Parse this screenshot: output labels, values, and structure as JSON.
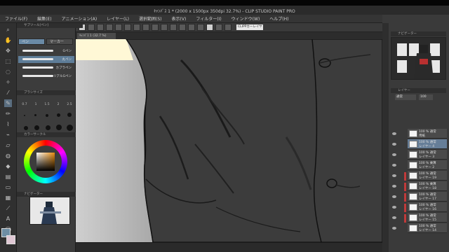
{
  "window": {
    "title": "ｷｬﾝﾊﾞｽ 1 * (2000 x 1500px 350dpi 32.7%) - CLIP STUDIO PAINT PRO"
  },
  "menu": [
    "ファイル(F)",
    "編集(E)",
    "アニメーション(A)",
    "レイヤー(L)",
    "選択範囲(S)",
    "表示(V)",
    "フィルター(I)",
    "ウィンドウ(W)",
    "ヘルプ(H)"
  ],
  "commandbar": {
    "field_text": "CLIPPカーレイヤー"
  },
  "tab": {
    "label": "ｷｬﾝﾊﾞｽ 1 (32.7 %)"
  },
  "subtool": {
    "header": "サブツール[ペン]",
    "tabs": [
      "ペン",
      "マーカー"
    ],
    "brushes": [
      {
        "label": "Gペン"
      },
      {
        "label": "丸ペン"
      },
      {
        "label": "カブラペン"
      },
      {
        "label": "リアルGペン"
      }
    ]
  },
  "size": {
    "header": "ブラシサイズ",
    "values": [
      "0.7",
      "1",
      "1.5",
      "2",
      "2.5"
    ]
  },
  "color": {
    "header": "カラーサークル"
  },
  "navigator": {
    "header": "ナビゲーター"
  },
  "right": {
    "navigator_header": "ナビゲーター",
    "layer_header": "レイヤー",
    "blend": "通常",
    "opacity": "100",
    "layers": [
      {
        "name1": "100 % 通常",
        "name2": "用紙"
      },
      {
        "name1": "100 % 通常",
        "name2": "レイヤー 4"
      },
      {
        "name1": "100 % 通常",
        "name2": "レイヤー 3"
      },
      {
        "name1": "100 % 乗算",
        "name2": "レイヤー 2"
      },
      {
        "name1": "100 % 通常",
        "name2": "レイヤー 19"
      },
      {
        "name1": "100 % 乗算",
        "name2": "レイヤー 18"
      },
      {
        "name1": "100 % 通常",
        "name2": "レイヤー 17"
      },
      {
        "name1": "100 % 通常",
        "name2": "レイヤー 16"
      },
      {
        "name1": "100 % 通常",
        "name2": "レイヤー 15"
      },
      {
        "name1": "100 % 通常",
        "name2": "レイヤー 14"
      }
    ]
  }
}
